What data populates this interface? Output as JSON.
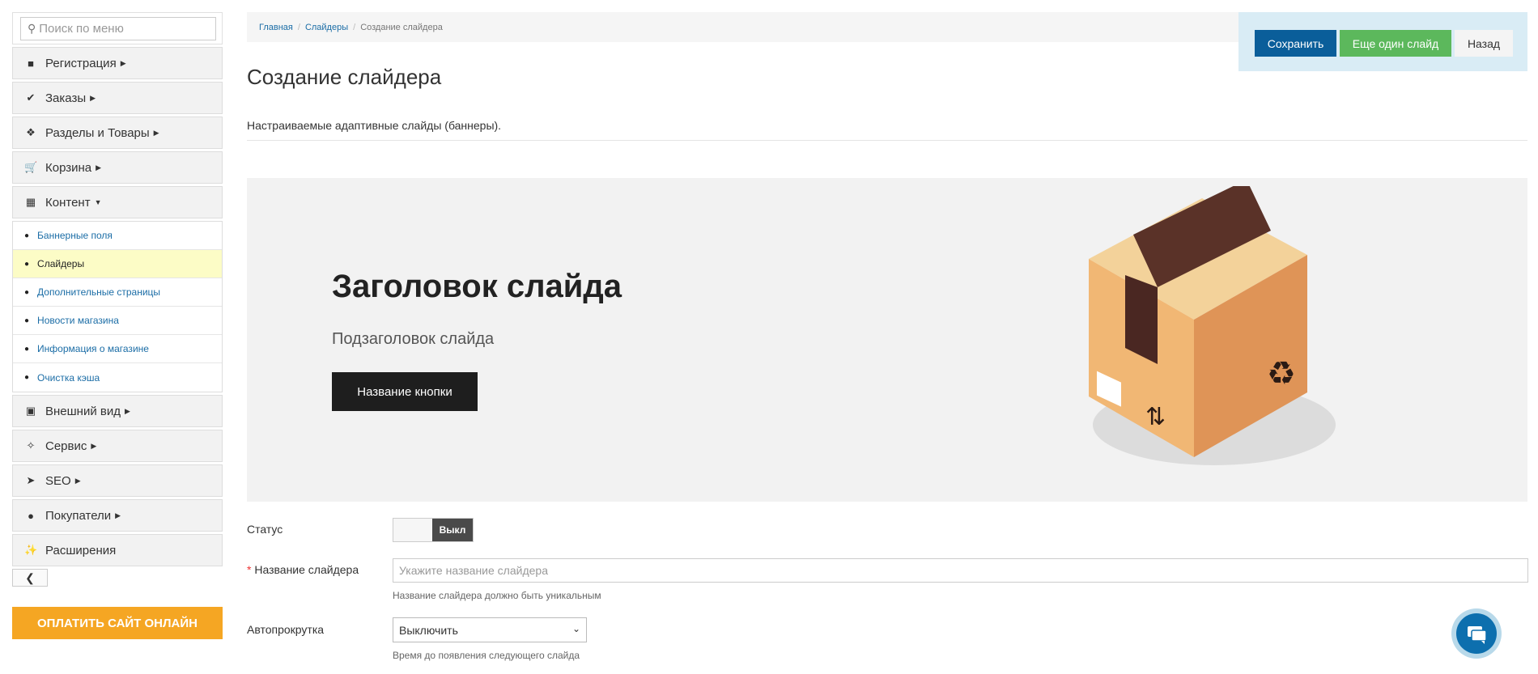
{
  "sidebar": {
    "search_placeholder": "Поиск по меню",
    "items": [
      {
        "label": "Регистрация",
        "icon": "briefcase-icon"
      },
      {
        "label": "Заказы",
        "icon": "check-circle-icon"
      },
      {
        "label": "Разделы и Товары",
        "icon": "cubes-icon"
      },
      {
        "label": "Корзина",
        "icon": "cart-icon"
      },
      {
        "label": "Контент",
        "icon": "grid-icon",
        "expanded": true
      }
    ],
    "content_sub": [
      {
        "label": "Баннерные поля"
      },
      {
        "label": "Слайдеры",
        "active": true
      },
      {
        "label": "Дополнительные страницы"
      },
      {
        "label": "Новости магазина"
      },
      {
        "label": "Информация о магазине"
      },
      {
        "label": "Очистка кэша"
      }
    ],
    "items_after": [
      {
        "label": "Внешний вид",
        "icon": "image-icon"
      },
      {
        "label": "Сервис",
        "icon": "wrench-icon"
      },
      {
        "label": "SEO",
        "icon": "rocket-icon"
      },
      {
        "label": "Покупатели",
        "icon": "user-icon"
      },
      {
        "label": "Расширения",
        "icon": "plug-icon"
      }
    ],
    "pay_button": "ОПЛАТИТЬ САЙТ ОНЛАЙН"
  },
  "breadcrumb": [
    "Главная",
    "Слайдеры",
    "Создание слайдера"
  ],
  "actions": {
    "save": "Сохранить",
    "another": "Еще один слайд",
    "back": "Назад"
  },
  "page": {
    "title": "Создание слайдера",
    "description": "Настраиваемые адаптивные слайды (баннеры)."
  },
  "slide": {
    "title": "Заголовок слайда",
    "subtitle": "Подзаголовок слайда",
    "button": "Название кнопки"
  },
  "form": {
    "status_label": "Статус",
    "status_value": "Выкл",
    "name_label": "Название слайдера",
    "name_placeholder": "Укажите название слайдера",
    "name_hint": "Название слайдера должно быть уникальным",
    "autoplay_label": "Автопрокрутка",
    "autoplay_value": "Выключить",
    "autoplay_hint": "Время до появления следующего слайда"
  },
  "colors": {
    "primary": "#0a5e9a",
    "success": "#5cb85c",
    "pay": "#f5a623",
    "active_row": "#fcfcc6"
  }
}
